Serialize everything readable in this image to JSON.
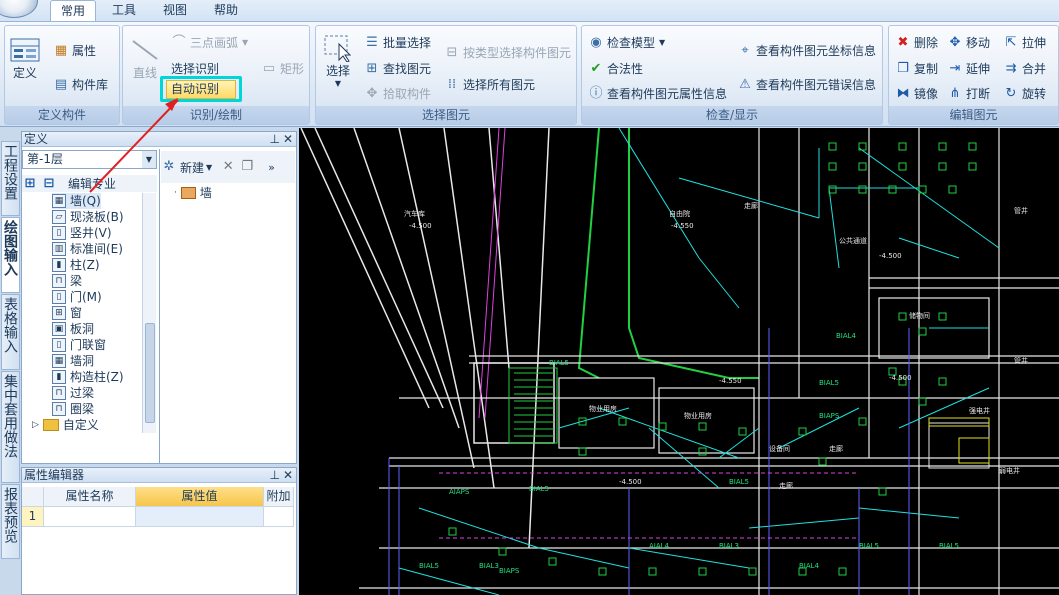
{
  "menu": {
    "tabs": [
      "常用",
      "工具",
      "视图",
      "帮助"
    ]
  },
  "ribbon": {
    "define": {
      "title": "定义构件",
      "define_label": "定义",
      "attr_label": "属性",
      "lib_label": "构件库"
    },
    "recognize": {
      "title": "识别/绘制",
      "line_label": "直线",
      "arc_label": "三点画弧",
      "select_recognize_label": "选择识别",
      "rect_label": "矩形",
      "auto_label": "自动识别"
    },
    "select": {
      "title": "选择图元",
      "select_label": "选择",
      "batch_label": "批量选择",
      "find_label": "查找图元",
      "pick_label": "拾取构件",
      "bytype_label": "按类型选择构件图元",
      "all_label": "选择所有图元"
    },
    "check": {
      "title": "检查/显示",
      "check_model_label": "检查模型",
      "legal_label": "合法性",
      "view_attr_label": "查看构件图元属性信息",
      "view_coord_label": "查看构件图元坐标信息",
      "view_error_label": "查看构件图元错误信息"
    },
    "edit": {
      "title": "编辑图元",
      "delete_label": "删除",
      "move_label": "移动",
      "stretch_label": "拉伸",
      "copy_label": "复制",
      "extend_label": "延伸",
      "merge_label": "合并",
      "mirror_label": "镜像",
      "break_label": "打断",
      "rotate_label": "旋转"
    }
  },
  "sidebar": {
    "tabs": [
      "工程设置",
      "绘图输入",
      "表格输入",
      "集中套用做法",
      "报表预览"
    ]
  },
  "define_panel": {
    "title": "定义",
    "floor": "第-1层",
    "edit_pro_label": "编辑专业",
    "new_label": "新建",
    "tree": [
      "墙(Q)",
      "现浇板(B)",
      "竖井(V)",
      "标准间(E)",
      "柱(Z)",
      "梁",
      "门(M)",
      "窗",
      "板洞",
      "门联窗",
      "墙洞",
      "构造柱(Z)",
      "过梁",
      "圈梁"
    ],
    "custom_label": "自定义",
    "list_item": "墙"
  },
  "prop_editor": {
    "title": "属性编辑器",
    "columns": [
      "属性名称",
      "属性值",
      "附加"
    ],
    "row_index": "1"
  },
  "cad_labels": [
    "汽车库",
    "-4.500",
    "自由院",
    "-4.550",
    "走廊",
    "公共通道",
    "-4.500",
    "-4.550",
    "储物间",
    "-4.500",
    "BIAL4",
    "BIAL5",
    "BIAL5",
    "BIAPS",
    "物业用房",
    "物业用房",
    "走廊",
    "设备间",
    "BIAL5",
    "-4.500",
    "AIAPS",
    "BIAL5",
    "AIAL4",
    "BIAL3",
    "BIAL5",
    "BIAL4",
    "BIAL5",
    "BIAL3",
    "BIAPS",
    "BIAL5",
    "强电井",
    "弱电井",
    "管井",
    "管井",
    "走廊"
  ],
  "colors": {
    "accent": "#00d6d6",
    "arrow": "#e02020",
    "ribbon_bg": "#dfe9f5",
    "cad_bg": "#000000"
  }
}
